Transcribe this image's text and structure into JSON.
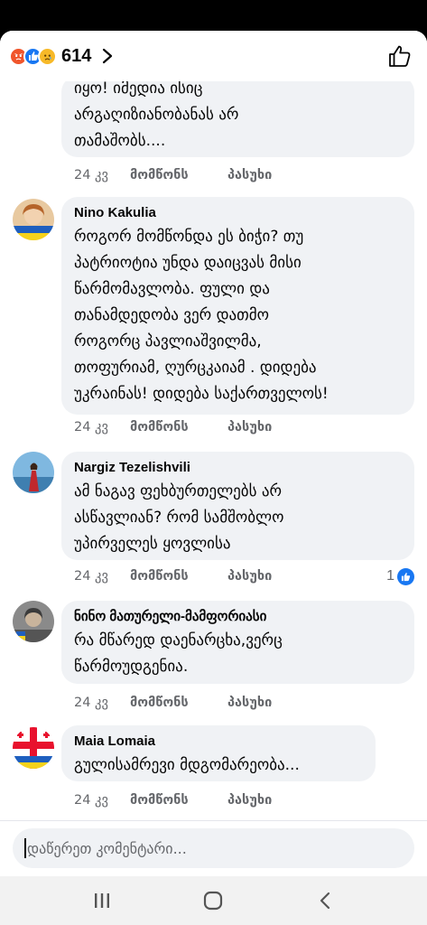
{
  "header": {
    "reaction_icons": [
      "angry-icon",
      "like-icon",
      "sad-icon"
    ],
    "reaction_count": "614",
    "accent": "#1877f2"
  },
  "comments": [
    {
      "author": "",
      "lines": [
        "იყო! იმედია ისიც",
        "არგაღიზიანობანას არ",
        "თამაშობს...."
      ],
      "time": "24 კვ",
      "like_label": "მომწონს",
      "reply_label": "პასუხი"
    },
    {
      "author": "Nino Kakulia",
      "lines": [
        "როგორ მომწონდა ეს ბიჭი? თუ",
        "პატრიოტია უნდა დაიცვას მისი",
        "წარმომავლობა.  ფული და",
        "თანამდედობა ვერ დათმო",
        "როგორც პავლიაშვილმა,",
        "თოფურიამ, ღურცკაიამ . დიდება",
        "უკრაინას! დიდება საქართველოს!"
      ],
      "time": "24 კვ",
      "like_label": "მომწონს",
      "reply_label": "პასუხი"
    },
    {
      "author": "Nargiz Tezelishvili",
      "lines": [
        "ამ ნაგავ ფეხბურთელებს არ",
        "ასწავლიან? რომ სამშობლო",
        "უპირველეს ყოვლისა"
      ],
      "time": "24 კვ",
      "like_label": "მომწონს",
      "reply_label": "პასუხი",
      "reaction_count": "1"
    },
    {
      "author": "ნინო მათურელი-მამფორიასი",
      "lines": [
        "რა მწარედ დაენარცხა,ვერც",
        "წარმოუდგენია."
      ],
      "time": "24 კვ",
      "like_label": "მომწონს",
      "reply_label": "პასუხი"
    },
    {
      "author": "Maia Lomaia",
      "lines": [
        "გულისამრევი მდგომარეობა..."
      ],
      "time": "24 კვ",
      "like_label": "მომწონს",
      "reply_label": "პასუხი"
    }
  ],
  "composer": {
    "placeholder": "დაწერეთ კომენტარი..."
  },
  "navbar": {
    "icons": [
      "recent-apps-icon",
      "home-icon",
      "back-icon"
    ]
  }
}
